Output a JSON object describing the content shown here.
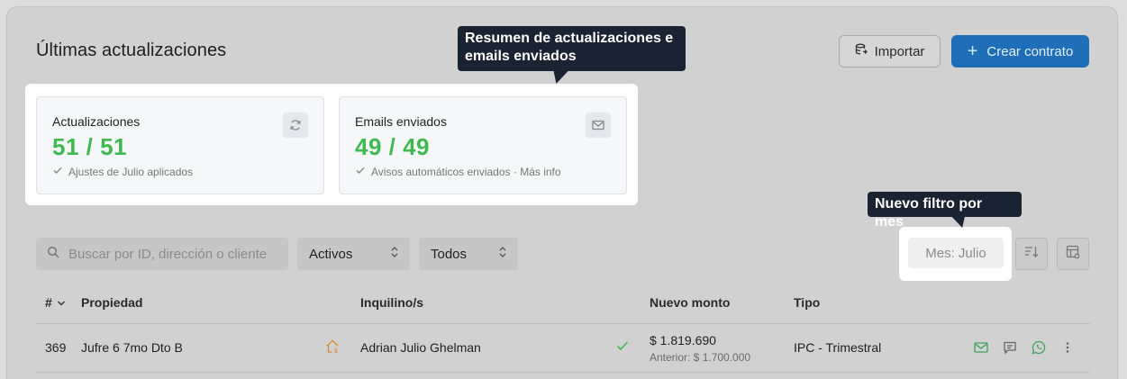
{
  "header": {
    "title": "Últimas actualizaciones",
    "import_label": "Importar",
    "create_label": "Crear contrato"
  },
  "callouts": {
    "stats": "Resumen de actualizaciones e emails enviados",
    "filter": "Nuevo filtro por mes"
  },
  "stats": [
    {
      "label": "Actualizaciones",
      "value": "51 / 51",
      "sub": "Ajustes de Julio aplicados",
      "icon": "refresh-icon"
    },
    {
      "label": "Emails enviados",
      "value": "49 / 49",
      "sub": "Avisos automáticos enviados · Más info",
      "icon": "mail-icon"
    }
  ],
  "filters": {
    "search_placeholder": "Buscar por ID, dirección o cliente",
    "status_value": "Activos",
    "scope_value": "Todos",
    "month_chip": "Mes: Julio"
  },
  "table": {
    "columns": [
      "#",
      "Propiedad",
      "Inquilino/s",
      "Nuevo monto",
      "Tipo"
    ],
    "rows": [
      {
        "id": "369",
        "property": "Jufre 6 7mo Dto B",
        "tenant": "Adrian Julio Ghelman",
        "amount": "$ 1.819.690",
        "previous": "Anterior: $ 1.700.000",
        "type": "IPC - Trimestral"
      }
    ]
  },
  "colors": {
    "accent": "#1f6fb8",
    "success": "#3fb950",
    "callout_bg": "#1a2332",
    "house_icon": "#d98a2b",
    "whatsapp": "#3fa35a"
  }
}
